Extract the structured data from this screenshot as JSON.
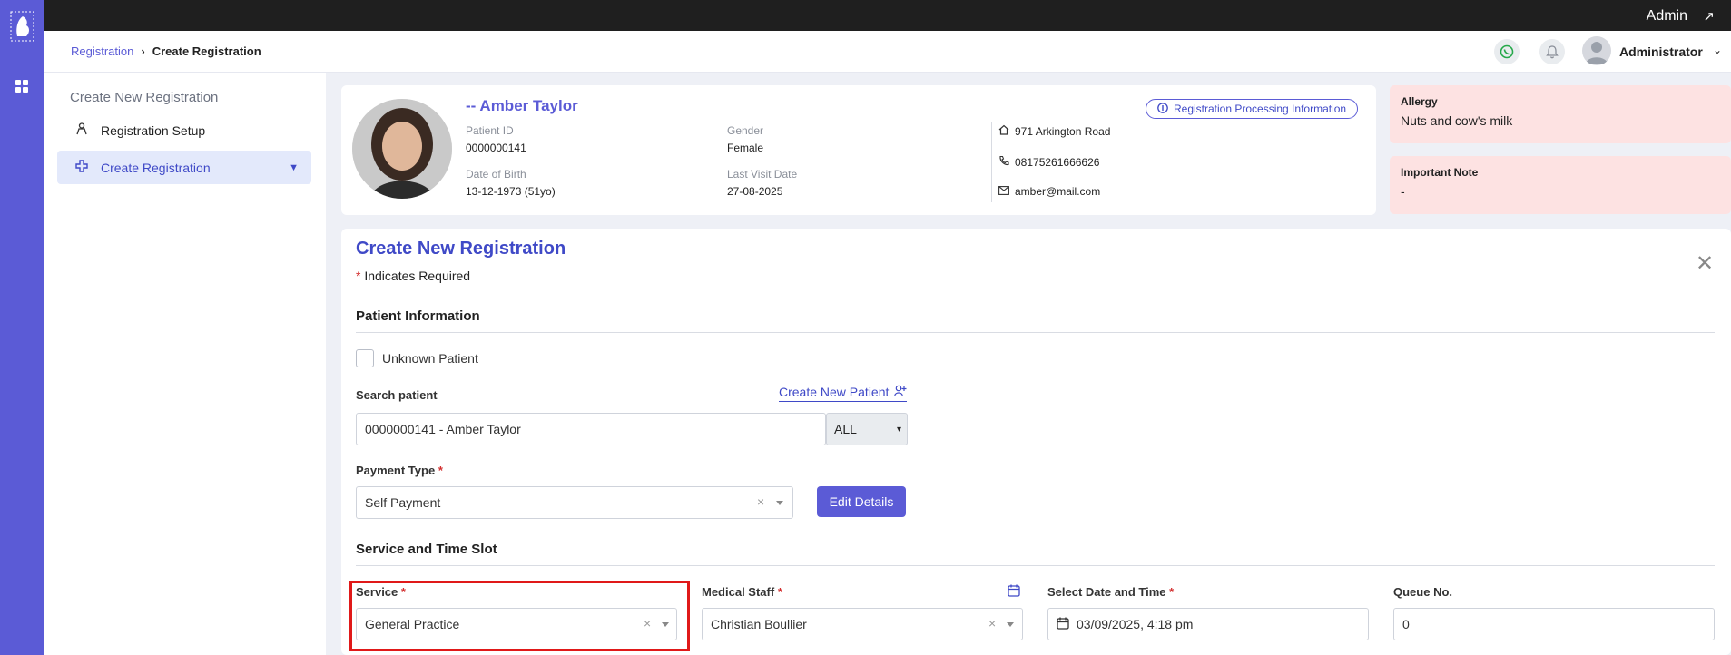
{
  "topbar": {
    "user_role": "Admin"
  },
  "breadcrumb": {
    "parent": "Registration",
    "current": "Create Registration"
  },
  "header": {
    "username": "Administrator"
  },
  "sidebar": {
    "title": "Create New Registration",
    "items": [
      {
        "label": "Registration Setup"
      },
      {
        "label": "Create Registration"
      }
    ]
  },
  "patient": {
    "name": "-- Amber Taylor",
    "id_label": "Patient ID",
    "id": "0000000141",
    "gender_label": "Gender",
    "gender": "Female",
    "dob_label": "Date of Birth",
    "dob": "13-12-1973 (51yo)",
    "last_visit_label": "Last Visit Date",
    "last_visit": "27-08-2025",
    "address": "971 Arkington Road",
    "phone": "08175261666626",
    "email": "amber@mail.com",
    "processing_info": "Registration Processing Information"
  },
  "allergy": {
    "label": "Allergy",
    "value": "Nuts and cow's milk"
  },
  "important_note": {
    "label": "Important Note",
    "value": "-"
  },
  "form": {
    "title": "Create New Registration",
    "required_note": "Indicates Required",
    "patient_info_heading": "Patient Information",
    "unknown_patient": "Unknown Patient",
    "search_label": "Search patient",
    "create_new_patient": "Create New Patient",
    "search_value": "0000000141 -  Amber Taylor",
    "search_filter": "ALL",
    "payment_type_label": "Payment Type",
    "payment_type_value": "Self Payment",
    "edit_details": "Edit Details",
    "service_heading": "Service and Time Slot",
    "service_label": "Service",
    "service_value": "General Practice",
    "staff_label": "Medical Staff",
    "staff_value": "Christian Boullier",
    "datetime_label": "Select Date and Time",
    "datetime_value": "03/09/2025, 4:18 pm",
    "queue_label": "Queue No.",
    "queue_value": "0"
  },
  "colors": {
    "accent": "#5b5bd6",
    "alert_bg": "#fde2e2",
    "highlight": "#e01919"
  }
}
